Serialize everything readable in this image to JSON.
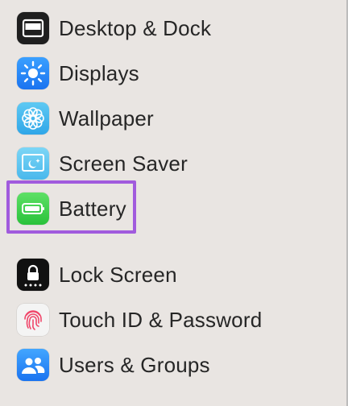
{
  "sidebar": {
    "items": [
      {
        "label": "Desktop & Dock",
        "icon": "desktop-dock-icon"
      },
      {
        "label": "Displays",
        "icon": "displays-icon"
      },
      {
        "label": "Wallpaper",
        "icon": "wallpaper-icon"
      },
      {
        "label": "Screen Saver",
        "icon": "screen-saver-icon"
      },
      {
        "label": "Battery",
        "icon": "battery-icon",
        "selected": true
      },
      {
        "label": "Lock Screen",
        "icon": "lock-screen-icon"
      },
      {
        "label": "Touch ID & Password",
        "icon": "touch-id-icon"
      },
      {
        "label": "Users & Groups",
        "icon": "users-groups-icon"
      }
    ]
  },
  "colors": {
    "background": "#e9e5e2",
    "highlight": "#a15bdd",
    "text": "#262626"
  }
}
